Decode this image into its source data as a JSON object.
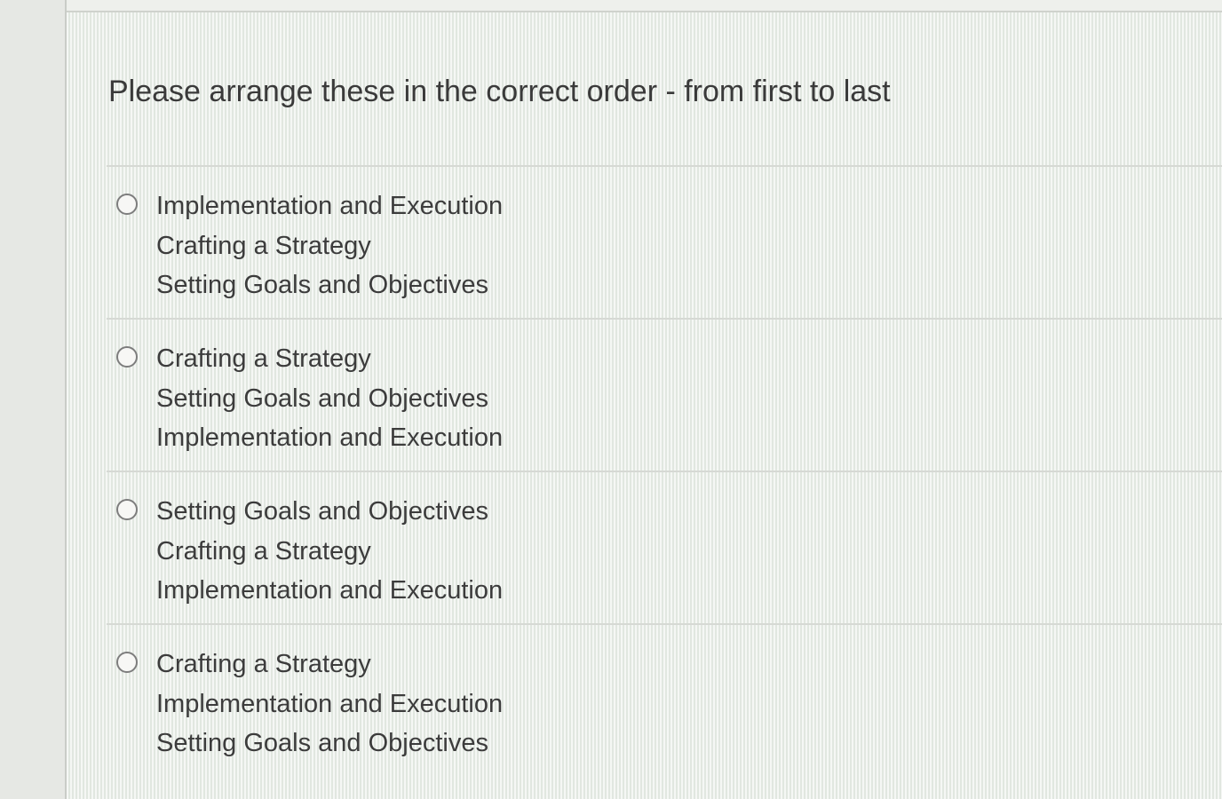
{
  "question": {
    "text": "Please arrange these in the correct order - from first to last"
  },
  "options": [
    {
      "lines": [
        "Implementation and Execution",
        "Crafting a Strategy",
        "Setting Goals and Objectives"
      ]
    },
    {
      "lines": [
        "Crafting a Strategy",
        "Setting Goals and Objectives",
        "Implementation and Execution"
      ]
    },
    {
      "lines": [
        "Setting Goals and Objectives",
        "Crafting a Strategy",
        "Implementation and Execution"
      ]
    },
    {
      "lines": [
        "Crafting a Strategy",
        "Implementation and Execution",
        "Setting Goals and Objectives"
      ]
    }
  ],
  "colors": {
    "text": "#3c3c3c",
    "divider": "#d6d9d4",
    "radio_border": "#7d7d7d",
    "background": "#e9eee8"
  }
}
